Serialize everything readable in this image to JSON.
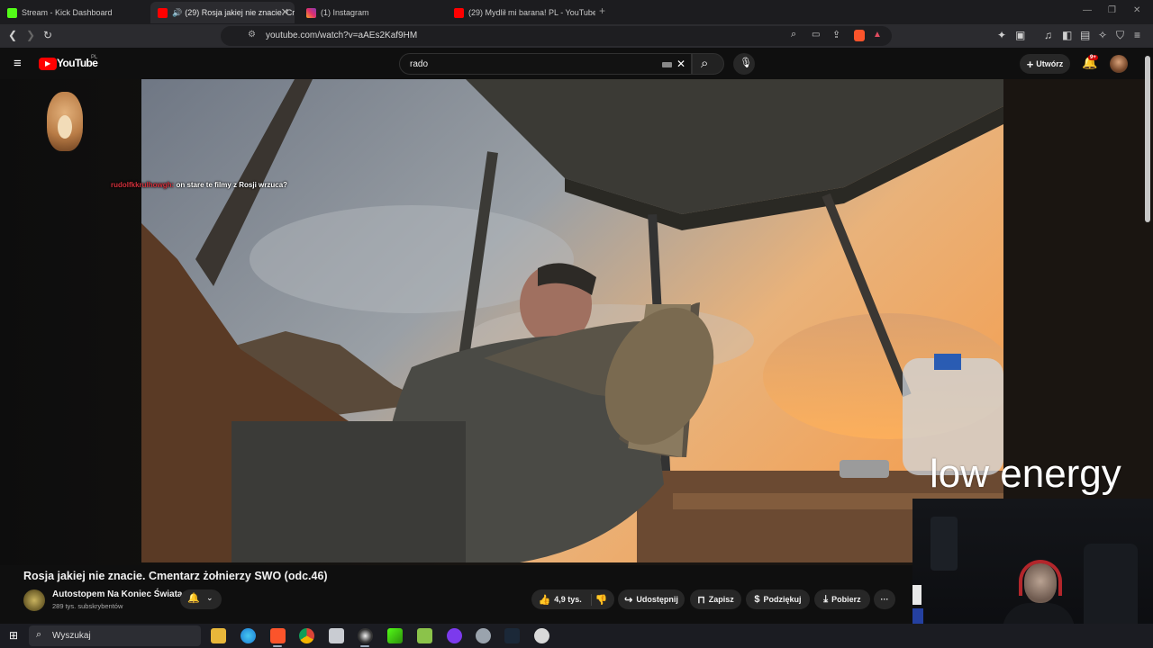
{
  "browser": {
    "tabs": [
      {
        "title": "Stream - Kick Dashboard",
        "favicon": "kick-icon",
        "color": "#53fc18"
      },
      {
        "title": "(29) Rosja jakiej nie znacie. Cr",
        "favicon": "youtube-icon",
        "color": "#ff0000"
      },
      {
        "title": "(1) Instagram",
        "favicon": "instagram-icon",
        "color": "#e1306c"
      },
      {
        "title": "(29) Mydlił mi barana! PL - YouTube",
        "favicon": "youtube-icon",
        "color": "#ff0000"
      }
    ],
    "new_tab": "+",
    "url": "youtube.com/watch?v=aAEs2Kaf9HM"
  },
  "youtube": {
    "logo_text": "YouTube",
    "logo_region": "PL",
    "search_value": "rado",
    "create_label": "Utwórz",
    "notification_count": "9+",
    "accent": "#ff0000"
  },
  "video": {
    "chat_user": "rudolfkkrulhowgh:",
    "chat_message": " on stare te filmy z Rosji wrzuca?",
    "overlay_text": "low energy",
    "title": "Rosja jakiej nie znacie. Cmentarz żołnierzy SWO (odc.46)",
    "channel_name": "Autostopem Na Koniec Świata",
    "subscribers": "289 tys. subskrybentów",
    "likes": "4,9 tys.",
    "share": "Udostępnij",
    "save": "Zapisz",
    "thanks": "Podziękuj",
    "download": "Pobierz",
    "more": "···"
  },
  "taskbar": {
    "search_label": "Wyszukaj"
  }
}
